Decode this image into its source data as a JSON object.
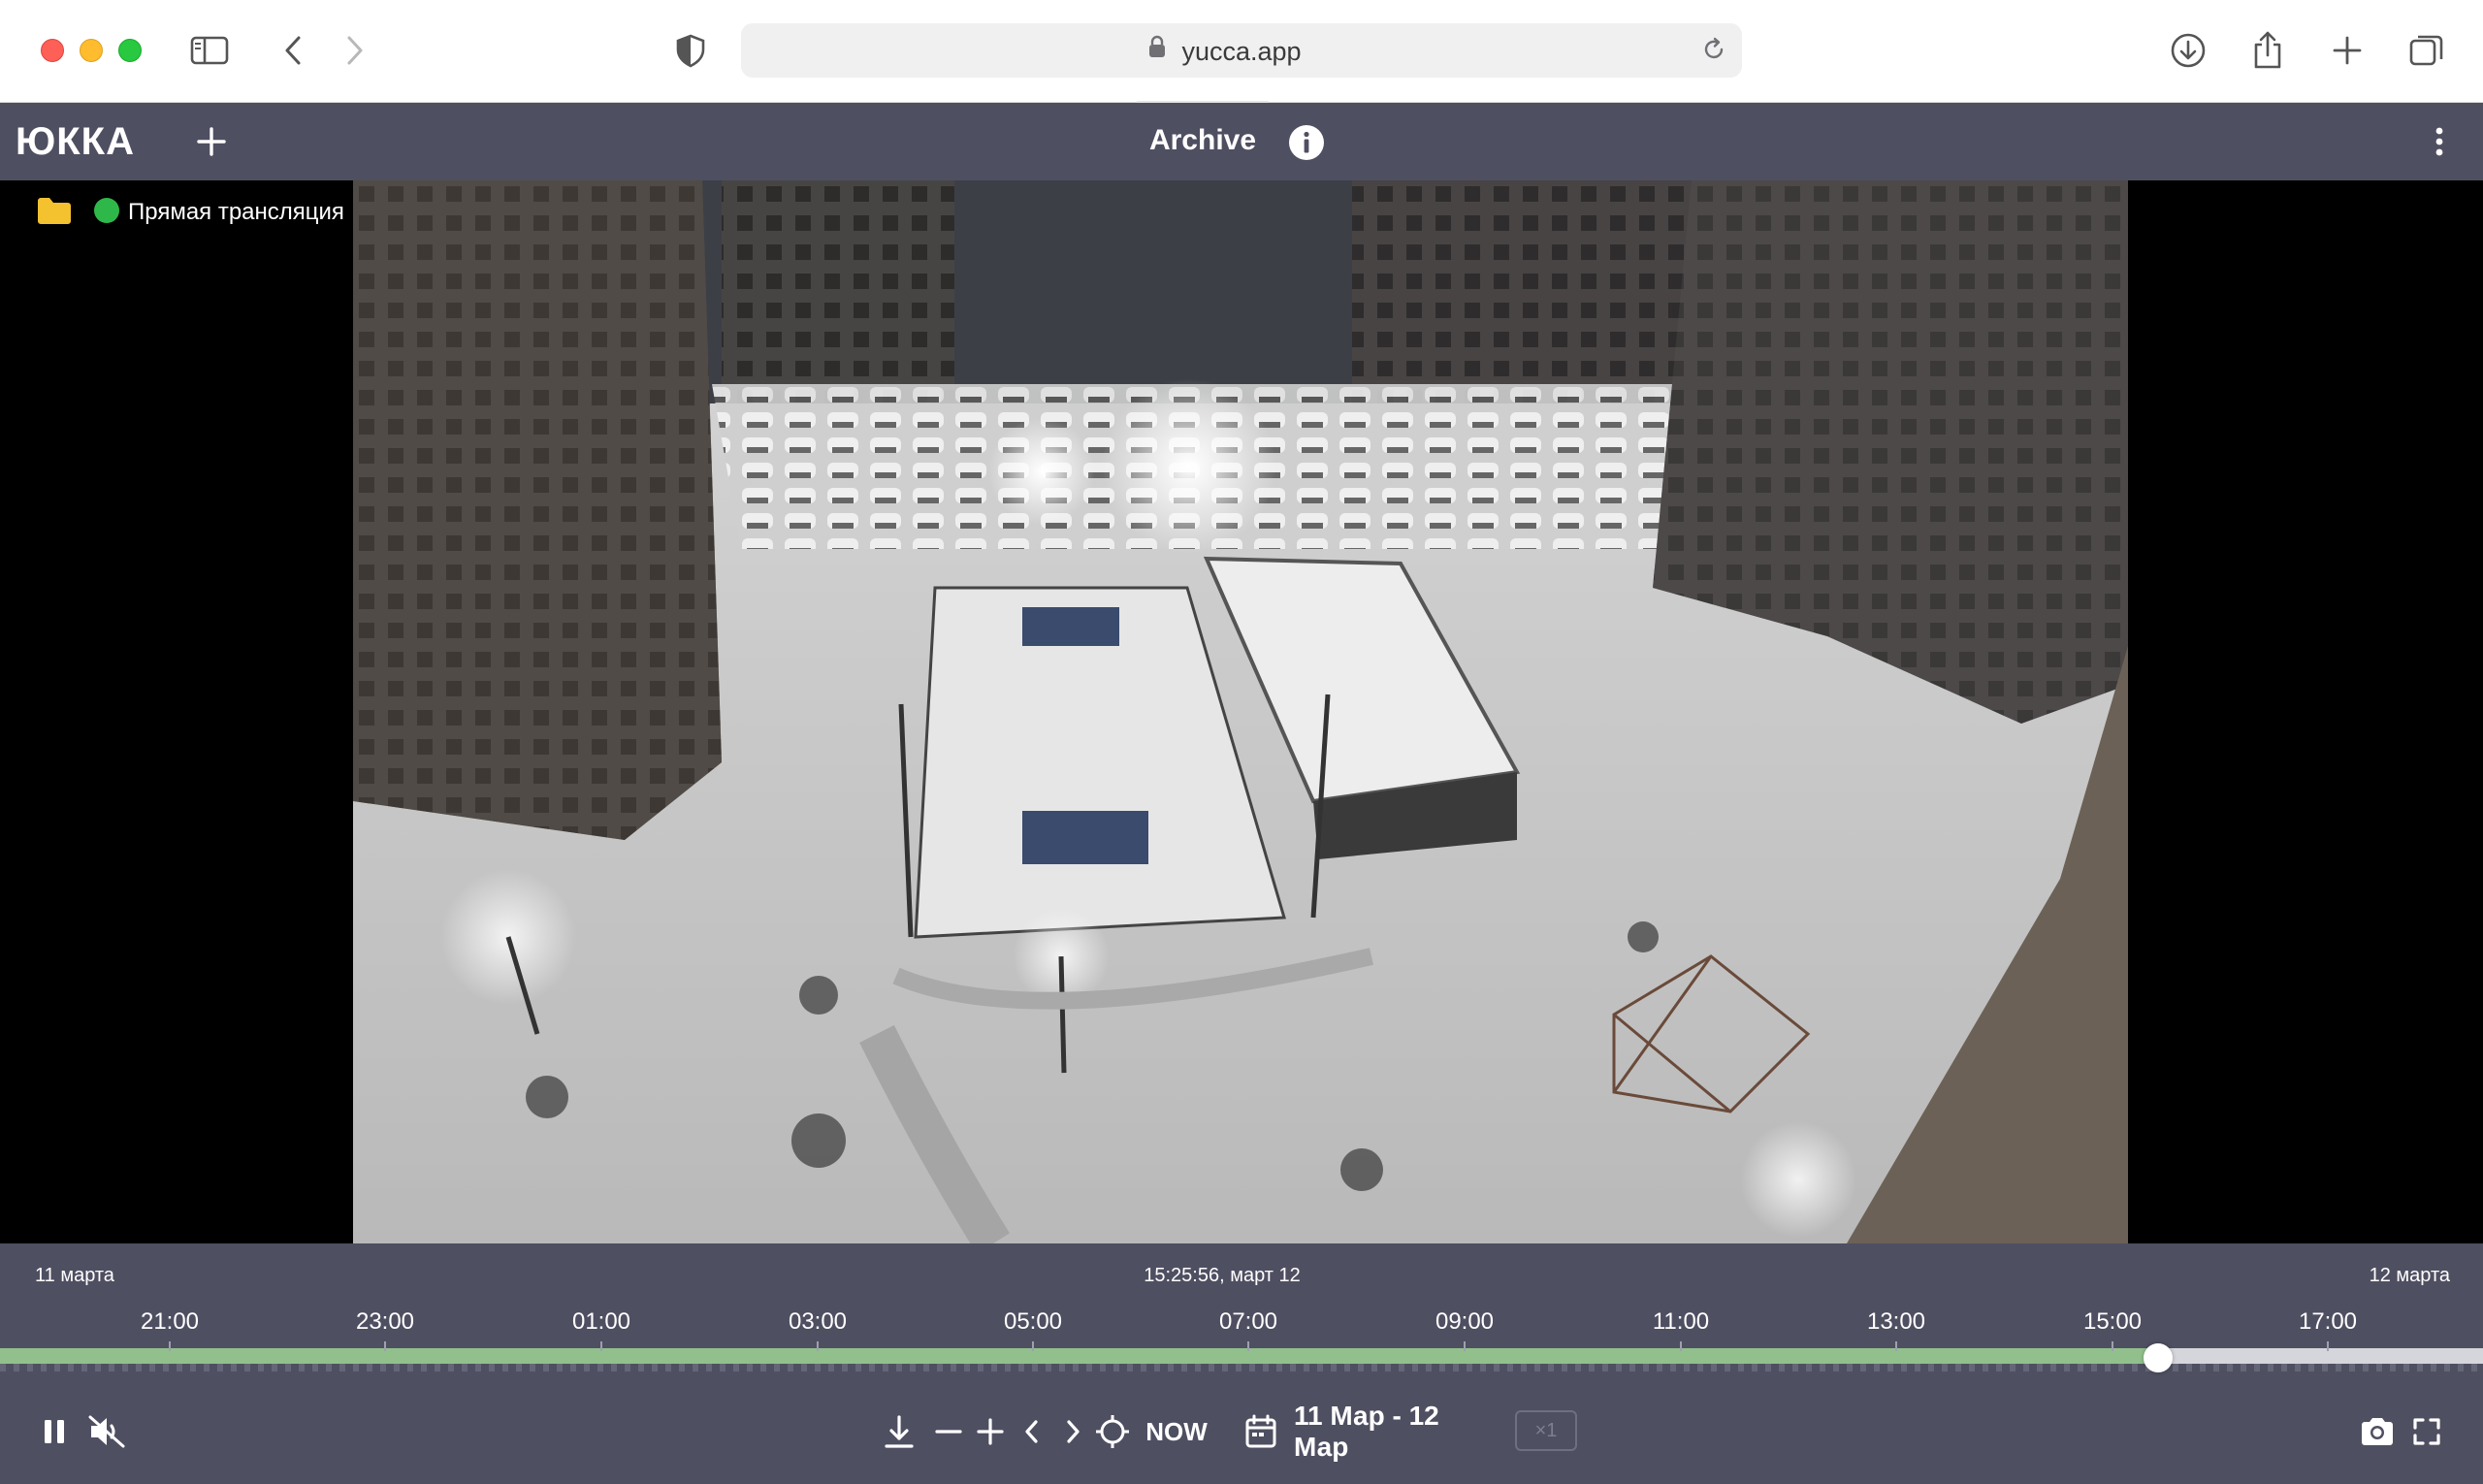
{
  "browser": {
    "url": "yucca.app",
    "icons": [
      "sidebar-icon",
      "back-icon",
      "forward-icon",
      "shield-icon",
      "lock-icon",
      "reload-icon",
      "download-icon",
      "share-icon",
      "new-tab-icon",
      "tabs-overview-icon"
    ]
  },
  "header": {
    "logo": "ЮККА",
    "title": "Archive",
    "icons": [
      "plus-icon",
      "info-icon",
      "more-vertical-icon"
    ]
  },
  "stream": {
    "label": "Прямая трансляция",
    "status_color": "#2fb84a",
    "folder_color": "#f4c12f"
  },
  "timeline": {
    "date_left": "11 марта",
    "current": "15:25:56, март 12",
    "date_right": "12 марта",
    "hours": [
      "21:00",
      "23:00",
      "01:00",
      "03:00",
      "05:00",
      "07:00",
      "09:00",
      "11:00",
      "13:00",
      "15:00",
      "17:00"
    ],
    "progress_fraction": 0.869,
    "fill_color": "#92c08d"
  },
  "controls": {
    "now_label": "NOW",
    "date_range": "11 Мар - 12 Мар",
    "speed": "×1",
    "icons": [
      "pause-icon",
      "mute-icon",
      "download-icon",
      "zoom-out-icon",
      "zoom-in-icon",
      "prev-icon",
      "next-icon",
      "target-icon",
      "calendar-icon",
      "camera-icon",
      "fullscreen-icon"
    ]
  },
  "colors": {
    "app_bar": "#4f4f62",
    "accent_green": "#92c08d"
  }
}
